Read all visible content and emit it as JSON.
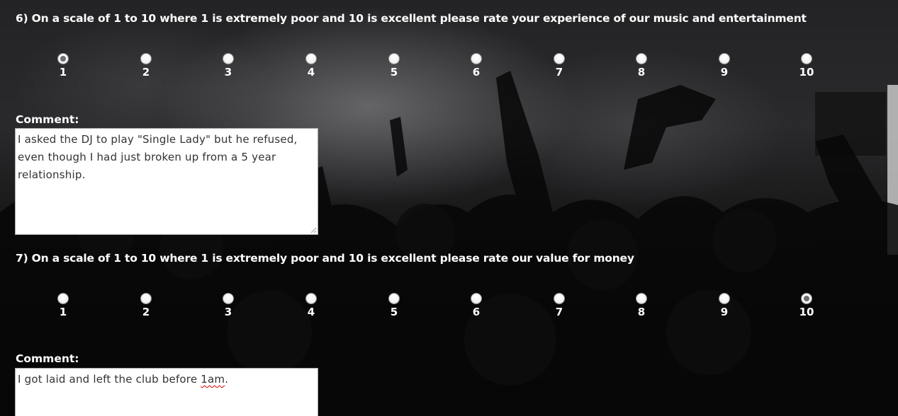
{
  "questions": [
    {
      "text": "6) On a scale of 1 to 10 where 1 is extremely poor and 10 is excellent please rate your experience of our music and entertainment",
      "options": [
        "1",
        "2",
        "3",
        "4",
        "5",
        "6",
        "7",
        "8",
        "9",
        "10"
      ],
      "selected": "1",
      "comment_label": "Comment:",
      "comment_text": "I asked the DJ to play \"Single Lady\" but he refused, even though I had just broken up from a 5 year relationship."
    },
    {
      "text": "7) On a scale of 1 to 10 where 1 is extremely poor and 10 is excellent please rate our value for money",
      "options": [
        "1",
        "2",
        "3",
        "4",
        "5",
        "6",
        "7",
        "8",
        "9",
        "10"
      ],
      "selected": "10",
      "comment_label": "Comment:",
      "comment_text_before": "I got laid and left the club before ",
      "comment_text_misspelled": "1am",
      "comment_text_after": "."
    }
  ],
  "icons": {
    "radio_unchecked": "radio-unchecked-icon",
    "radio_checked": "radio-checked-icon",
    "resize_grip": "resize-grip-icon"
  },
  "colors": {
    "text": "#ffffff",
    "radio_dot": "#6e6e6e",
    "spellcheck_underline": "#d80000"
  }
}
